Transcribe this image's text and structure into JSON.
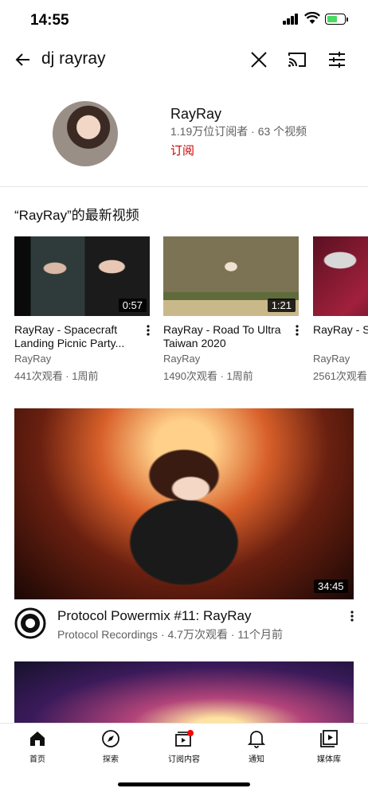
{
  "status_bar": {
    "time": "14:55"
  },
  "search": {
    "query": "dj rayray"
  },
  "channel": {
    "name": "RayRay",
    "meta": "1.19万位订阅者 · 63 个视频",
    "subscribe_label": "订阅"
  },
  "latest": {
    "title": "“RayRay”的最新视频",
    "videos": [
      {
        "title": "RayRay - Spacecraft Landing Picnic Party...",
        "channel": "RayRay",
        "meta": "441次观看 · 1周前",
        "duration": "0:57"
      },
      {
        "title": "RayRay - Road To Ultra Taiwan 2020",
        "channel": "RayRay",
        "meta": "1490次观看 · 1周前",
        "duration": "1:21"
      },
      {
        "title": "RayRay - Sp Emergency",
        "channel": "RayRay",
        "meta": "2561次观看",
        "duration": ""
      }
    ]
  },
  "featured": {
    "title": "Protocol Powermix #11: RayRay",
    "meta": "Protocol Recordings · 4.7万次观看 · 11个月前",
    "duration": "34:45"
  },
  "bottom_nav": {
    "items": [
      {
        "label": "首页",
        "icon": "home-icon"
      },
      {
        "label": "探索",
        "icon": "compass-icon"
      },
      {
        "label": "订阅内容",
        "icon": "subscriptions-icon"
      },
      {
        "label": "通知",
        "icon": "bell-icon"
      },
      {
        "label": "媒体库",
        "icon": "library-icon"
      }
    ]
  },
  "colors": {
    "subscribe_red": "#cc0000",
    "battery_green": "#4cd964",
    "text_secondary": "#606060"
  }
}
